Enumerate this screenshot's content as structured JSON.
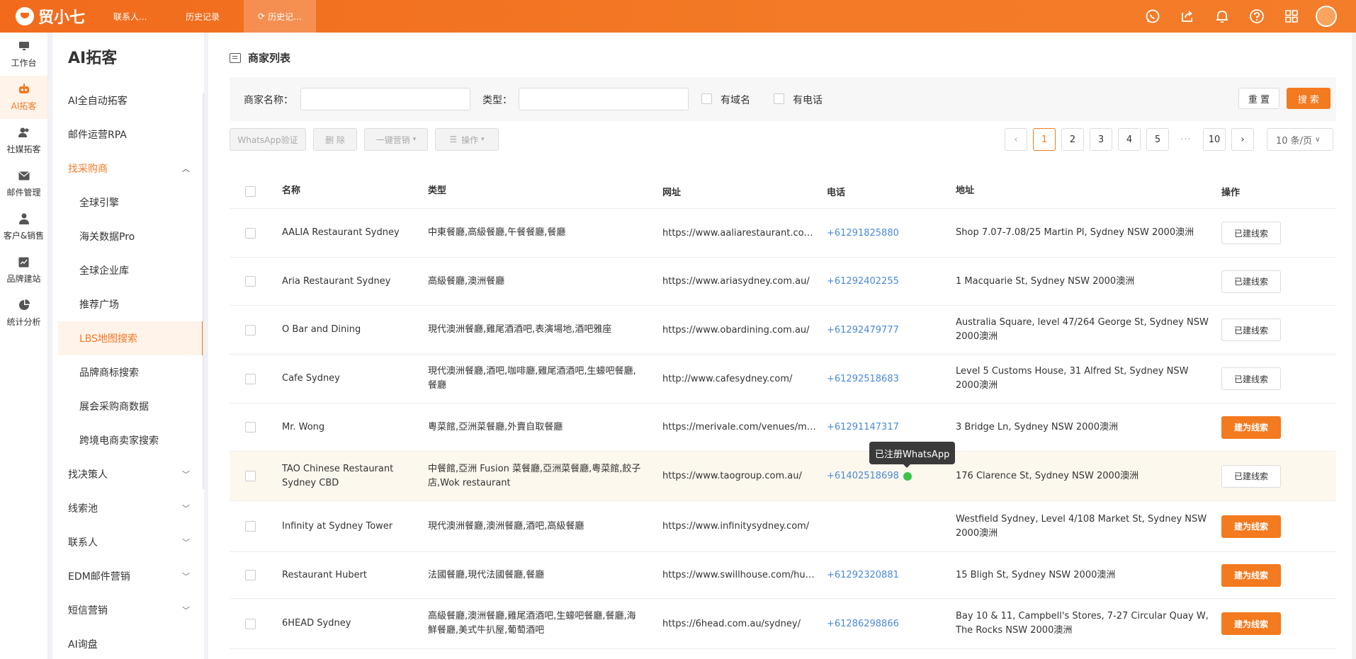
{
  "app": {
    "logo": "贸小七"
  },
  "top_tabs": [
    {
      "label": "联系人..."
    },
    {
      "label": "历史记录"
    },
    {
      "label": "历史记..."
    }
  ],
  "rail": [
    {
      "label": "工作台"
    },
    {
      "label": "AI拓客"
    },
    {
      "label": "社媒拓客"
    },
    {
      "label": "邮件管理"
    },
    {
      "label": "客户&销售"
    },
    {
      "label": "品牌建站"
    },
    {
      "label": "统计分析"
    }
  ],
  "menu": {
    "title": "AI拓客",
    "items": [
      {
        "label": "AI全自动拓客"
      },
      {
        "label": "邮件运营RPA"
      },
      {
        "label": "找采购商"
      },
      {
        "label": "全球引擎"
      },
      {
        "label": "海关数据Pro"
      },
      {
        "label": "全球企业库"
      },
      {
        "label": "推荐广场"
      },
      {
        "label": "LBS地图搜索"
      },
      {
        "label": "品牌商标搜索"
      },
      {
        "label": "展会采购商数据"
      },
      {
        "label": "跨境电商卖家搜索"
      },
      {
        "label": "找决策人"
      },
      {
        "label": "线索池"
      },
      {
        "label": "联系人"
      },
      {
        "label": "EDM邮件营销"
      },
      {
        "label": "短信营销"
      },
      {
        "label": "AI询盘"
      }
    ]
  },
  "panel": {
    "title": "商家列表"
  },
  "filter": {
    "name_label": "商家名称：",
    "type_label": "类型：",
    "has_domain": "有域名",
    "has_phone": "有电话",
    "reset": "重 置",
    "search": "搜 索"
  },
  "toolbar": {
    "whatsapp": "WhatsApp验证",
    "delete": "删 除",
    "marketing": "一键营销",
    "ops": "操作"
  },
  "pagination": {
    "pages": [
      "1",
      "2",
      "3",
      "4",
      "5",
      "10"
    ],
    "ellipsis": "···",
    "page_size": "10 条/页",
    "current": 1
  },
  "table": {
    "headers": {
      "name": "名称",
      "type": "类型",
      "url": "网址",
      "phone": "电话",
      "addr": "地址",
      "op": "操作"
    },
    "rows": [
      {
        "name": "AALIA Restaurant Sydney",
        "type": "中東餐廳,高級餐廳,午餐餐廳,餐廳",
        "url": "https://www.aaliarestaurant.com.au/",
        "phone": "+61291825880",
        "addr": "Shop 7.07-7.08/25 Martin Pl, Sydney NSW 2000澳洲",
        "op": "已建线索"
      },
      {
        "name": "Aria Restaurant Sydney",
        "type": "高級餐廳,澳洲餐廳",
        "url": "https://www.ariasydney.com.au/",
        "phone": "+61292402255",
        "addr": "1 Macquarie St, Sydney NSW 2000澳洲",
        "op": "已建线索"
      },
      {
        "name": "O Bar and Dining",
        "type": "現代澳洲餐廳,雞尾酒酒吧,表演場地,酒吧雅座",
        "url": "https://www.obardining.com.au/",
        "phone": "+61292479777",
        "addr": "Australia Square, level 47/264 George St, Sydney NSW 2000澳洲",
        "op": "已建线索"
      },
      {
        "name": "Cafe Sydney",
        "type": "現代澳洲餐廳,酒吧,咖啡廳,雞尾酒酒吧,生蠔吧餐廳,餐廳",
        "url": "http://www.cafesydney.com/",
        "phone": "+61292518683",
        "addr": "Level 5 Customs House, 31 Alfred St, Sydney NSW 2000澳洲",
        "op": "已建线索"
      },
      {
        "name": "Mr. Wong",
        "type": "粵菜館,亞洲菜餐廳,外賣自取餐廳",
        "url": "https://merivale.com/venues/mrwong/",
        "phone": "+61291147317",
        "addr": "3 Bridge Ln, Sydney NSW 2000澳洲",
        "op": "建为线索"
      },
      {
        "name": "TAO Chinese Restaurant Sydney CBD",
        "type": "中餐館,亞洲 Fusion 菜餐廳,亞洲菜餐廳,粵菜館,餃子店,Wok restaurant",
        "url": "https://www.taogroup.com.au/",
        "phone": "+61402518698",
        "addr": "176 Clarence St, Sydney NSW 2000澳洲",
        "op": "已建线索",
        "whatsapp": true
      },
      {
        "name": "Infinity at Sydney Tower",
        "type": "現代澳洲餐廳,澳洲餐廳,酒吧,高級餐廳",
        "url": "https://www.infinitysydney.com/",
        "phone": "",
        "addr": "Westfield Sydney, Level 4/108 Market St, Sydney NSW 2000澳洲",
        "op": "建为线索"
      },
      {
        "name": "Restaurant Hubert",
        "type": "法國餐廳,現代法國餐廳,餐廳",
        "url": "https://www.swillhouse.com/hubert",
        "phone": "+61292320881",
        "addr": "15 Bligh St, Sydney NSW 2000澳洲",
        "op": "建为线索"
      },
      {
        "name": "6HEAD Sydney",
        "type": "高級餐廳,澳洲餐廳,雞尾酒酒吧,生蠔吧餐廳,餐廳,海鮮餐廳,美式牛扒屋,葡萄酒吧",
        "url": "https://6head.com.au/sydney/",
        "phone": "+61286298866",
        "addr": "Bay 10 & 11, Campbell's Stores, 7-27 Circular Quay W, The Rocks NSW 2000澳洲",
        "op": "建为线索"
      }
    ]
  },
  "tooltip": "已注册WhatsApp",
  "colors": {
    "accent": "#f37a1f",
    "link": "#4a8ad6",
    "highlight_row": "#fdf8ed"
  }
}
